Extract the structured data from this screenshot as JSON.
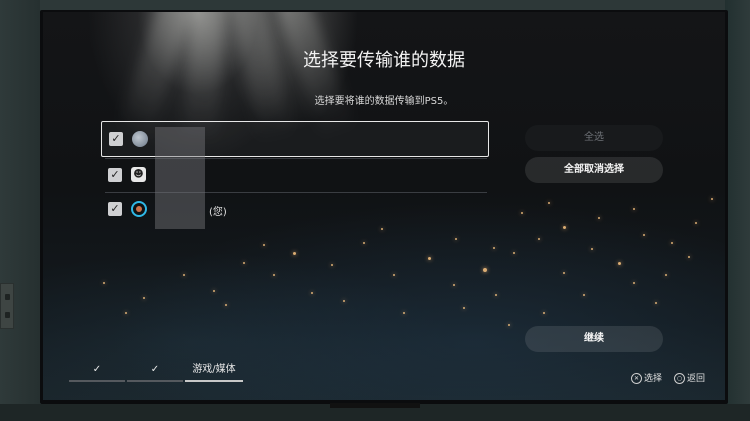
{
  "screen": {
    "title": "选择要传输谁的数据",
    "subtitle": "选择要将谁的数据传输到PS5。"
  },
  "users": [
    {
      "checked": true,
      "avatar": "user-avatar-photo",
      "name_suffix": "",
      "focused": true
    },
    {
      "checked": true,
      "avatar": "smiley-avatar",
      "name_suffix": "",
      "focused": false
    },
    {
      "checked": true,
      "avatar": "ring-avatar",
      "name_suffix": "(您)",
      "focused": false
    }
  ],
  "buttons": {
    "select_all": "全选",
    "deselect_all": "全部取消选择",
    "continue": "继续"
  },
  "steps": [
    {
      "label": "✓",
      "state": "done"
    },
    {
      "label": "✓",
      "state": "done"
    },
    {
      "label": "游戏/媒体",
      "state": "current"
    }
  ],
  "hints": {
    "select": {
      "glyph": "✕",
      "label": "选择"
    },
    "back": {
      "glyph": "○",
      "label": "返回"
    }
  },
  "colors": {
    "accent_bar": "#c8c8c8",
    "step_bar_inactive": "#55595e"
  }
}
